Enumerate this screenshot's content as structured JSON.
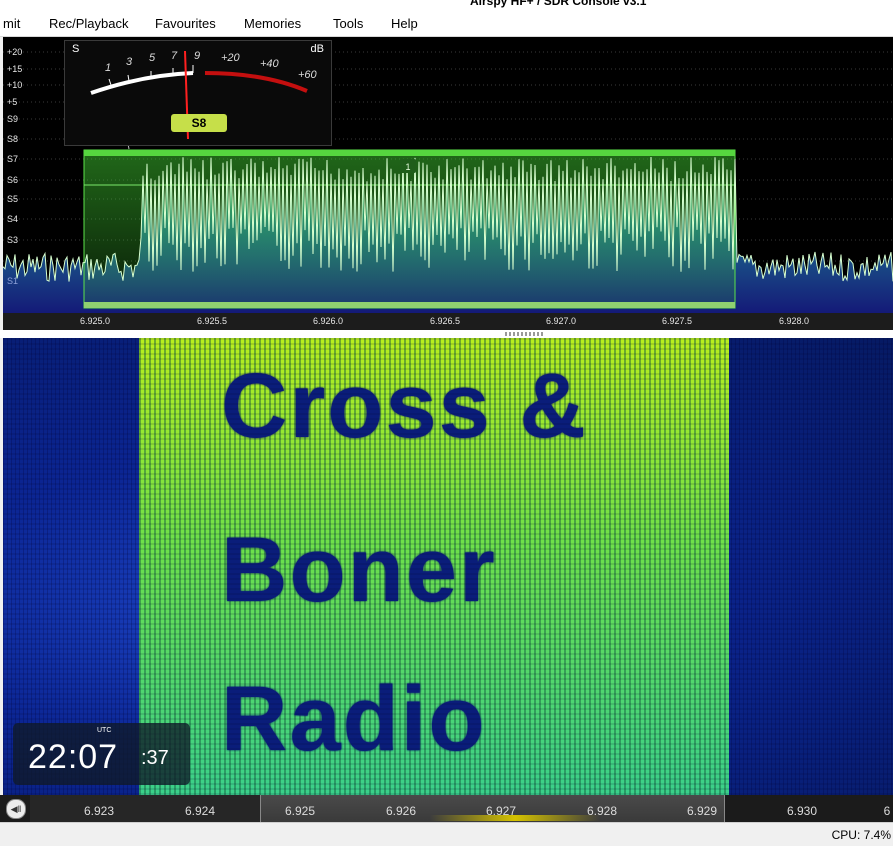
{
  "window": {
    "title": "Airspy HF+ / SDR Console v3.1"
  },
  "menu": {
    "items": [
      {
        "label": "mit"
      },
      {
        "label": "Rec/Playback"
      },
      {
        "label": "Favourites"
      },
      {
        "label": "Memories"
      },
      {
        "label": "Tools"
      },
      {
        "label": "Help"
      }
    ]
  },
  "spectrum": {
    "y_labels": [
      "+20",
      "+15",
      "+10",
      "+5",
      "S9",
      "S8",
      "S7",
      "S6",
      "S5",
      "S4",
      "S3",
      "S1"
    ],
    "freq_ticks": [
      "6.925.0",
      "6.925.5",
      "6.926.0",
      "6.926.5",
      "6.927.0",
      "6.927.5",
      "6.928.0"
    ],
    "vfo_marker": "1",
    "filter_color": "#3fb82c",
    "trace_color": "#d8ffd0"
  },
  "smeter": {
    "s_label": "S",
    "db_label": "dB",
    "scale_s": [
      "1",
      "3",
      "5",
      "7",
      "9"
    ],
    "scale_db": [
      "+20",
      "+40",
      "+60"
    ],
    "reading": "S8"
  },
  "waterfall": {
    "text_lines": [
      "Cross   &",
      "Boner",
      "Radio"
    ],
    "background_color": "#0b2593",
    "signal_color": "#9be42f"
  },
  "clock": {
    "tz": "UTC",
    "hours_minutes": "22:07",
    "seconds": ":37"
  },
  "bottom_axis": {
    "ticks": [
      "6.923",
      "6.924",
      "6.925",
      "6.926",
      "6.927",
      "6.928",
      "6.929",
      "6.930",
      "6"
    ]
  },
  "status": {
    "cpu": "CPU: 7.4%"
  }
}
